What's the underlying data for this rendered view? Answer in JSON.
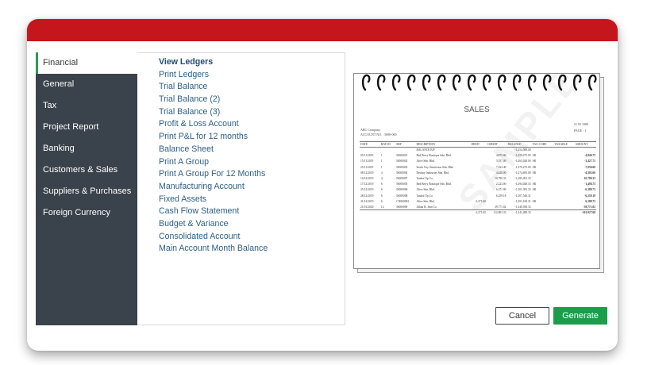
{
  "sidebar": {
    "items": [
      {
        "label": "Financial",
        "active": true
      },
      {
        "label": "General"
      },
      {
        "label": "Tax"
      },
      {
        "label": "Project Report"
      },
      {
        "label": "Banking"
      },
      {
        "label": "Customers & Sales"
      },
      {
        "label": "Suppliers & Purchases"
      },
      {
        "label": "Foreign Currency"
      }
    ]
  },
  "menu": {
    "items": [
      {
        "label": "View Ledgers",
        "active": true
      },
      {
        "label": "Print Ledgers"
      },
      {
        "label": "Trial Balance"
      },
      {
        "label": "Trial Balance (2)"
      },
      {
        "label": "Trial Balance (3)"
      },
      {
        "label": "Profit & Loss Account"
      },
      {
        "label": "Print P&L for 12 months"
      },
      {
        "label": "Balance Sheet"
      },
      {
        "label": "Print A Group"
      },
      {
        "label": "Print A Group For 12 Months"
      },
      {
        "label": "Manufacturing Account"
      },
      {
        "label": "Fixed Assets"
      },
      {
        "label": "Cash Flow Statement"
      },
      {
        "label": "Budget & Variance"
      },
      {
        "label": "Consolidated Account"
      },
      {
        "label": "Main Account Month Balance"
      }
    ]
  },
  "report": {
    "title": "SALES",
    "company": "ABC Company",
    "account_no": "ACCOUNT NO. : 5000-000",
    "code": "51 92 1080",
    "page": "PAGE : 1",
    "watermark": "SAMPLE",
    "columns": [
      "DATE",
      "BATCH",
      "REF",
      "DESCRIPTION",
      "DEBIT",
      "CREDIT",
      "BALANCE",
      "TAX CODE",
      "TAXABLE",
      "AMOUNT"
    ],
    "rows": [
      [
        "",
        "",
        "",
        "BALANCE B/F",
        "",
        "",
        "-1,254,500.00",
        "",
        "",
        ""
      ],
      [
        "05/11/2019",
        "1",
        "IS000001",
        "Red Berry Boutique Sdn. Bhd.",
        "",
        "4,875.00",
        "-1,259,475.00",
        "SR",
        "",
        "-4,840.75"
      ],
      [
        "15/11/2019",
        "1",
        "IS000002",
        "Alive Sdn. Bhd.",
        "",
        "3,557.00",
        "-1,263,028.00",
        "SR",
        "",
        "-3,427.75"
      ],
      [
        "25/11/2019",
        "1",
        "IS000003",
        "South City Streetwear Sdn. Bhd.",
        "",
        "7,223.40",
        "-1,270,275.00",
        "SR",
        "",
        "-7,830.00"
      ],
      [
        "08/12/2019",
        "4",
        "IS000004",
        "Destiny Industries Sdn. Bhd.",
        "",
        "4,420.00",
        "-1,274,695.00",
        "SR",
        "",
        "-4,303.00"
      ],
      [
        "14/12/2019",
        "4",
        "IS000007",
        "Tankof Up Co.",
        "",
        "10,790.33",
        "-1,285,491.33",
        "",
        "",
        "-10,790.33"
      ],
      [
        "17/12/2019",
        "6",
        "IS000005",
        "Red Berry Boutique Sdn. Bhd.",
        "",
        "2,223.00",
        "-1,294,028.33",
        "SR",
        "",
        "-1,498.75"
      ],
      [
        "25/12/2019",
        "6",
        "IS000006",
        "Alive Sdn. Bhd.",
        "",
        "6,371.00",
        "-1,301,393.33",
        "SR",
        "",
        "-6,388.75"
      ],
      [
        "28/12/2019",
        "6",
        "IS000008",
        "Tankof Up Co.",
        "",
        "6,259.18",
        "-1,307,540.31",
        "",
        "",
        "-6,259.18"
      ],
      [
        "31/12/2019",
        "6",
        "CN000002",
        "Alive Sdn. Bhd.",
        "6,371.00",
        "",
        "-1,301,169.31",
        "SR",
        "",
        "6,388.75"
      ],
      [
        "21/01/2020",
        "12",
        "IS000009",
        "Jillian B. Jean Co.",
        "",
        "39,771.02",
        "-1,340,938.33",
        "",
        "",
        "-39,771.02"
      ]
    ],
    "totals": [
      "6,371.00",
      "112,803.33",
      "-1,341,488.33",
      "-101,927.68"
    ]
  },
  "buttons": {
    "cancel": "Cancel",
    "generate": "Generate"
  },
  "colors": {
    "brand_red": "#c4161c",
    "sidebar_bg": "#3a424b",
    "active_accent": "#2a9d4e",
    "link_blue": "#2e5f86",
    "generate_green": "#1a9e49"
  }
}
